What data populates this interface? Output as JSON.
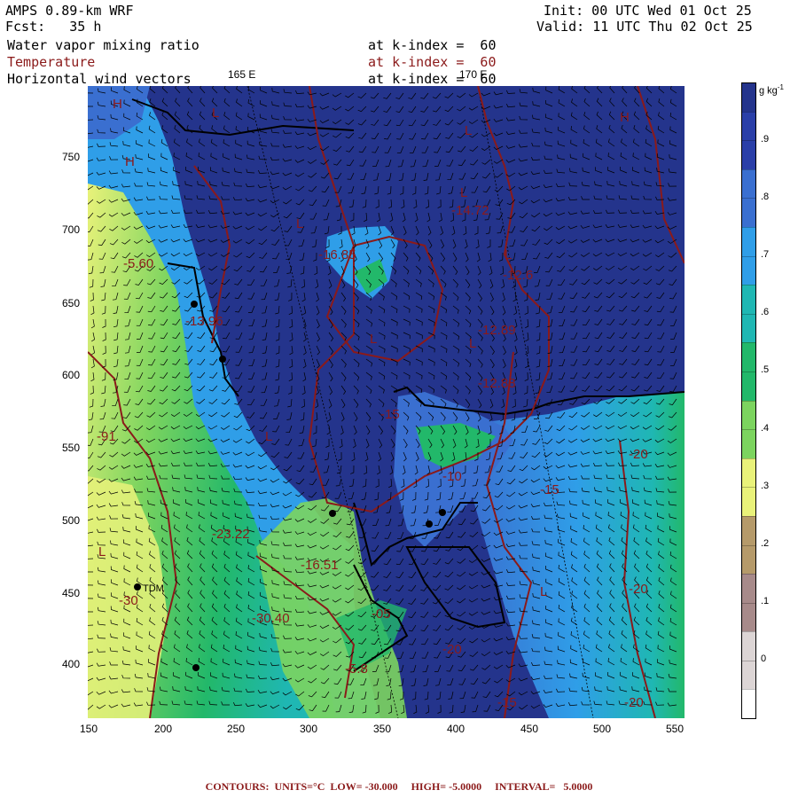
{
  "header": {
    "model": "AMPS 0.89-km WRF",
    "forecast": "Fcst:   35 h",
    "init": "Init: 00 UTC Wed 01 Oct 25",
    "valid": "Valid: 11 UTC Thu 02 Oct 25",
    "fields": [
      {
        "name": "Water vapor mixing ratio",
        "level": "at k-index =  60",
        "color": "#000000"
      },
      {
        "name": "Temperature",
        "level": "at k-index =  60",
        "color": "#8b1a1a"
      },
      {
        "name": "Horizontal wind vectors",
        "level": "at k-index =  60",
        "color": "#000000"
      }
    ]
  },
  "map": {
    "meridian_labels": [
      "165 E",
      "170 E"
    ],
    "x_ticks": [
      "150",
      "200",
      "250",
      "300",
      "350",
      "400",
      "450",
      "500",
      "550"
    ],
    "y_ticks": [
      "750",
      "700",
      "650",
      "600",
      "550",
      "500",
      "450",
      "400"
    ],
    "x_range": [
      140,
      560
    ],
    "y_range": [
      360,
      790
    ],
    "station_labels": [
      "TDM"
    ],
    "hl_labels": [
      "H",
      "H",
      "L",
      "L",
      "L",
      "L",
      "L",
      "L",
      "L",
      "L",
      "L",
      "H",
      "L"
    ],
    "contour_labels": [
      "-5.60",
      "-13.96",
      "-16.85",
      "-14.72",
      "-12.6",
      "-12.89",
      "-12.88",
      "-15",
      "-91",
      "-23.22",
      "-16.51",
      "-30",
      "-30.40",
      "-05",
      "-5.8",
      "-10",
      "-20",
      "-15",
      "-20",
      "-20",
      "-15",
      "-20"
    ]
  },
  "colorbar": {
    "unit": "g kg",
    "unit_sup": "-1",
    "levels": [
      {
        "label": ".9",
        "color": "#2a3fa8"
      },
      {
        "label": ".8",
        "color": "#3a6fd0"
      },
      {
        "label": ".7",
        "color": "#2f9ee8"
      },
      {
        "label": ".6",
        "color": "#1fb7b3"
      },
      {
        "label": ".5",
        "color": "#22b86a"
      },
      {
        "label": ".4",
        "color": "#7cd45f"
      },
      {
        "label": ".3",
        "color": "#e9f27a"
      },
      {
        "label": ".2",
        "color": "#b59a6a"
      },
      {
        "label": ".1",
        "color": "#a78a8a"
      },
      {
        "label": "0",
        "color": "#dcd5d5"
      }
    ],
    "extra_colors": [
      "#24348c",
      "#ffffff"
    ]
  },
  "footer": {
    "text": "CONTOURS:  UNITS=°C  LOW= -30.000     HIGH= -5.0000     INTERVAL=   5.0000"
  }
}
